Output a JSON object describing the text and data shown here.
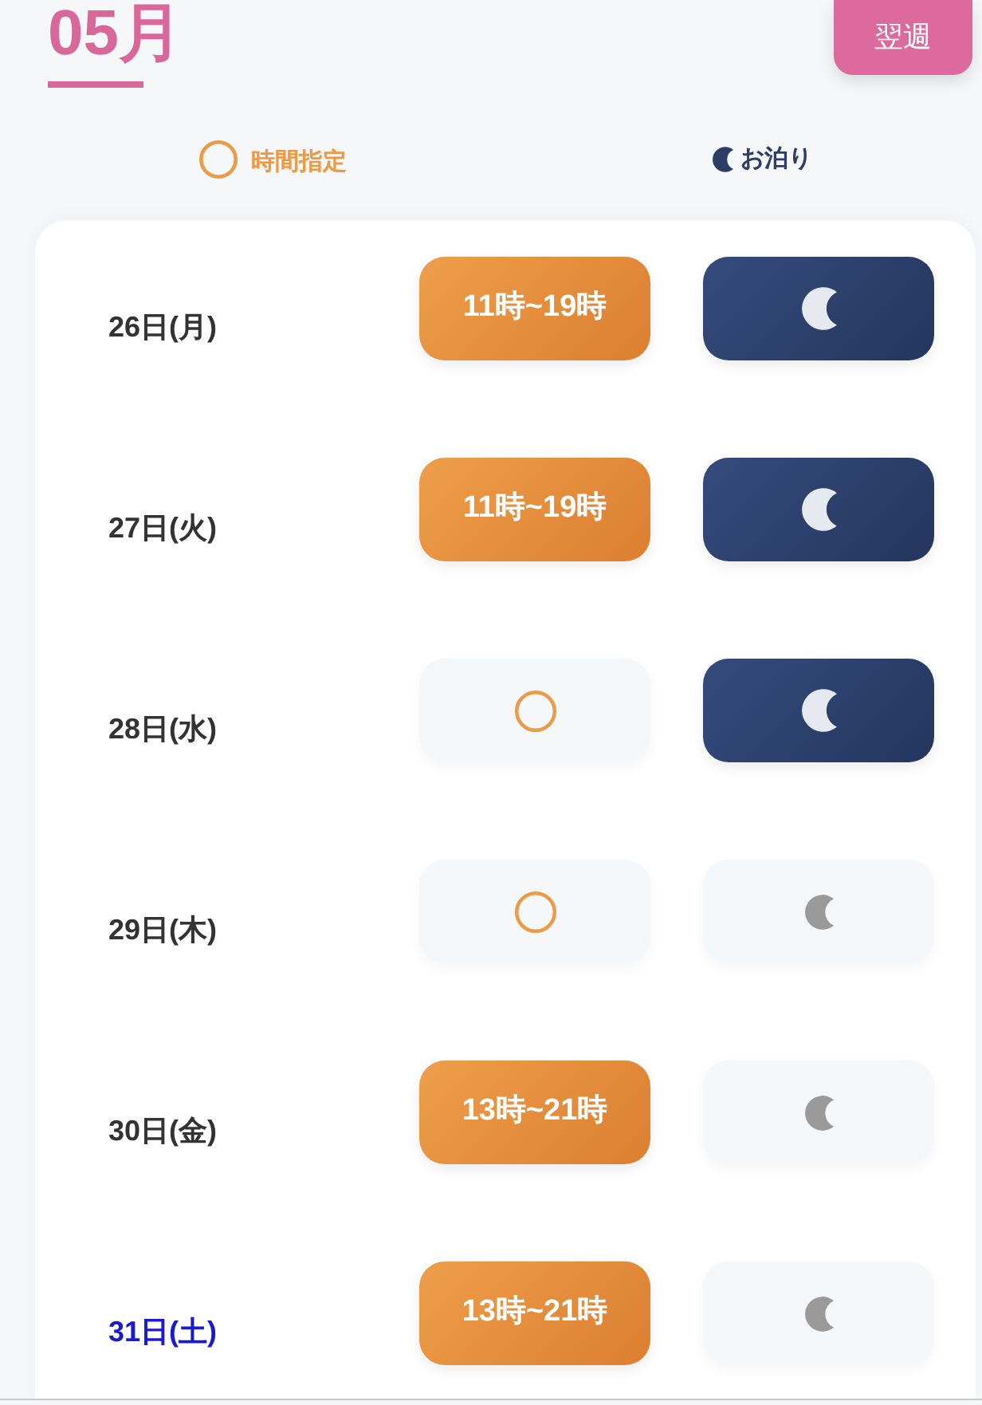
{
  "header": {
    "month": "05月",
    "next_button": "翌週"
  },
  "legend": [
    {
      "kind": "time",
      "label": "時間指定"
    },
    {
      "kind": "stay",
      "label": "お泊り"
    }
  ],
  "days": [
    {
      "date": "26日(月)",
      "color": "#333333",
      "time_slot": {
        "selected": true,
        "label": "11時~19時"
      },
      "stay": {
        "selected": true
      }
    },
    {
      "date": "27日(火)",
      "color": "#333333",
      "time_slot": {
        "selected": true,
        "label": "11時~19時"
      },
      "stay": {
        "selected": true
      }
    },
    {
      "date": "28日(水)",
      "color": "#333333",
      "time_slot": {
        "selected": false
      },
      "stay": {
        "selected": true
      }
    },
    {
      "date": "29日(木)",
      "color": "#333333",
      "time_slot": {
        "selected": false
      },
      "stay": {
        "selected": false
      }
    },
    {
      "date": "30日(金)",
      "color": "#333333",
      "time_slot": {
        "selected": true,
        "label": "13時~21時"
      },
      "stay": {
        "selected": false
      }
    },
    {
      "date": "31日(土)",
      "color": "#1a1ad0",
      "time_slot": {
        "selected": true,
        "label": "13時~21時"
      },
      "stay": {
        "selected": false
      }
    }
  ]
}
